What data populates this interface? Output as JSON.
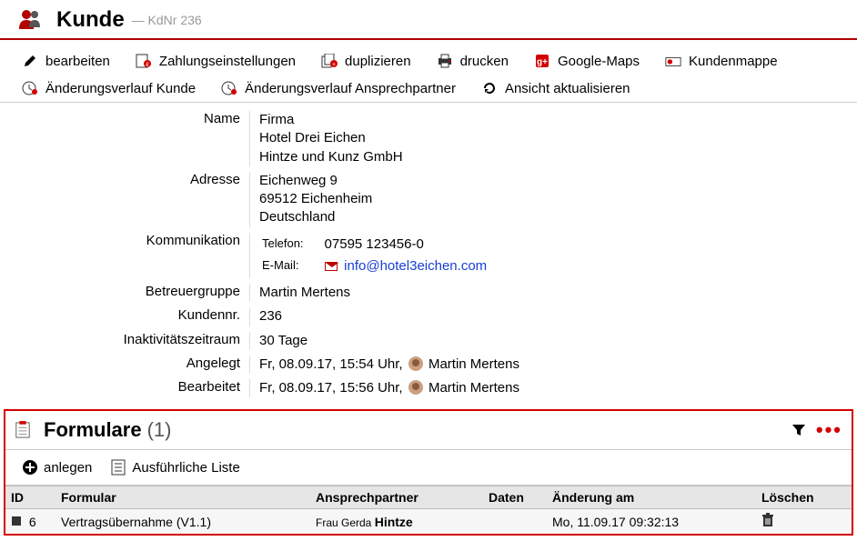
{
  "header": {
    "title": "Kunde",
    "subtitle": "— KdNr 236"
  },
  "toolbar": {
    "edit": "bearbeiten",
    "payment_settings": "Zahlungseinstellungen",
    "duplicate": "duplizieren",
    "print": "drucken",
    "googlemaps": "Google-Maps",
    "kundenmappe": "Kundenmappe",
    "history_customer": "Änderungsverlauf Kunde",
    "history_contact": "Änderungsverlauf Ansprechpartner",
    "refresh": "Ansicht aktualisieren"
  },
  "details": {
    "labels": {
      "name": "Name",
      "address": "Adresse",
      "communication": "Kommunikation",
      "betreuergruppe": "Betreuergruppe",
      "kundennr": "Kundennr.",
      "inaktiv": "Inaktivitätszeitraum",
      "angelegt": "Angelegt",
      "bearbeitet": "Bearbeitet"
    },
    "name_line1": "Firma",
    "name_line2": "Hotel Drei Eichen",
    "name_line3": "Hintze und Kunz GmbH",
    "addr_line1": "Eichenweg 9",
    "addr_line2": "69512 Eichenheim",
    "addr_line3": "Deutschland",
    "comm_phone_label": "Telefon:",
    "comm_phone_value": "07595 123456-0",
    "comm_email_label": "E-Mail:",
    "comm_email_value": "info@hotel3eichen.com",
    "betreuergruppe": "Martin Mertens",
    "kundennr": "236",
    "inaktiv": "30 Tage",
    "angelegt_time": "Fr, 08.09.17, 15:54 Uhr,",
    "angelegt_user": "Martin Mertens",
    "bearbeitet_time": "Fr, 08.09.17, 15:56 Uhr,",
    "bearbeitet_user": "Martin Mertens"
  },
  "panel": {
    "title": "Formulare",
    "count": "(1)",
    "create": "anlegen",
    "detailed_list": "Ausführliche Liste",
    "columns": {
      "id": "ID",
      "formular": "Formular",
      "ansprechpartner": "Ansprechpartner",
      "daten": "Daten",
      "aenderung": "Änderung am",
      "loeschen": "Löschen"
    },
    "rows": [
      {
        "id": "6",
        "formular": "Vertragsübernahme (V1.1)",
        "ansp_prefix": "Frau Gerda ",
        "ansp_bold": "Hintze",
        "daten": "",
        "aenderung": "Mo, 11.09.17 09:32:13"
      }
    ]
  }
}
